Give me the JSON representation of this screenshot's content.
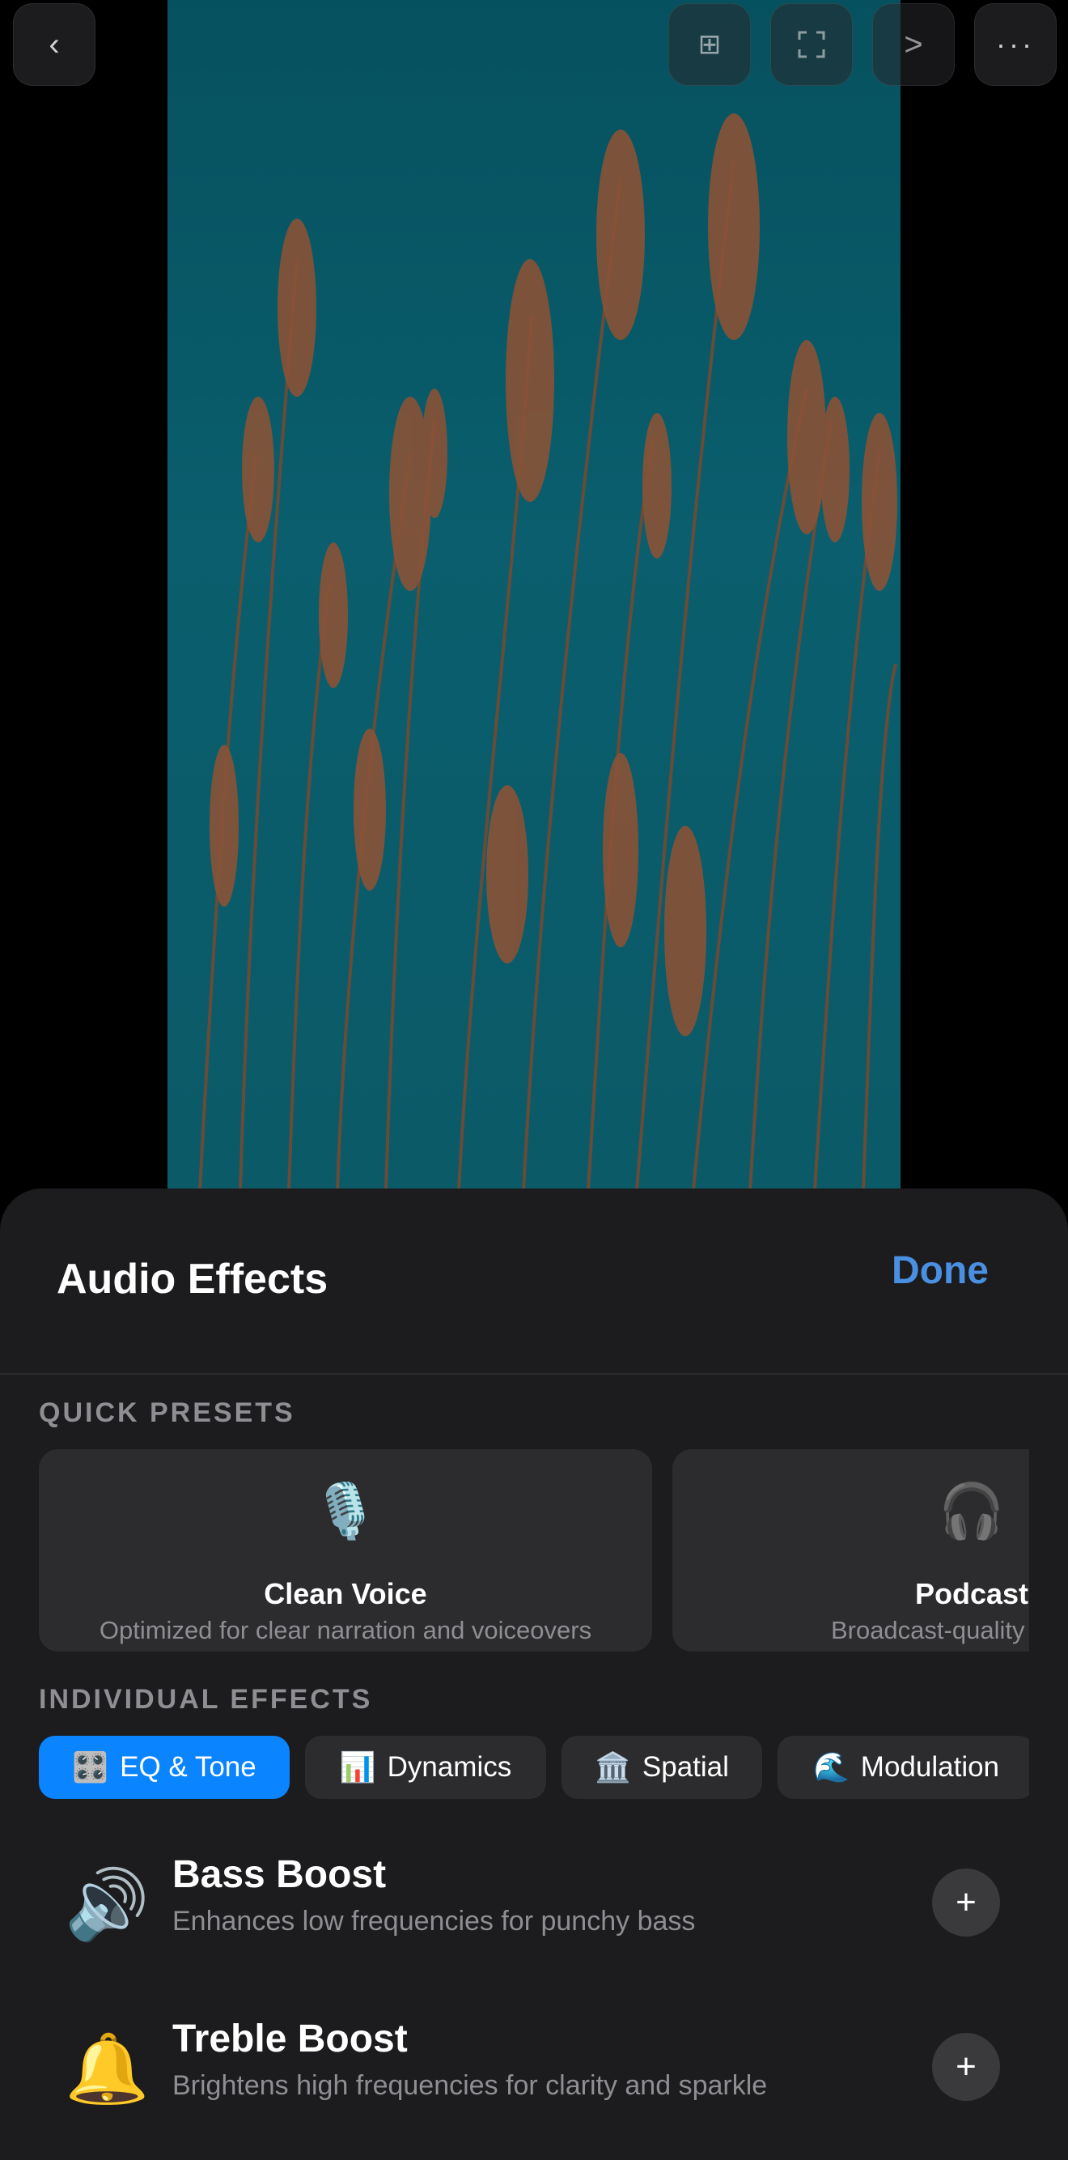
{
  "toolbar": {
    "back_icon": "chevron-left-icon",
    "grid_icon": "grid-icon",
    "fullscreen_icon": "fullscreen-icon",
    "next_label": ">",
    "more_icon": "ellipsis-icon"
  },
  "sheet": {
    "title": "Audio Effects",
    "done_label": "Done",
    "accent_color": "#4a90e2"
  },
  "quick_presets": {
    "label": "QUICK PRESETS",
    "items": [
      {
        "icon": "🎙️",
        "icon_name": "studio-microphone-icon",
        "name": "Clean Voice",
        "description": "Optimized for clear narration and voiceovers"
      },
      {
        "icon": "🎧",
        "icon_name": "headphones-icon",
        "name": "Podcast",
        "description": "Broadcast-quality speech"
      }
    ]
  },
  "individual_effects": {
    "label": "INDIVIDUAL EFFECTS",
    "tabs": [
      {
        "icon": "🎛️",
        "label": "EQ & Tone",
        "active": true
      },
      {
        "icon": "📊",
        "label": "Dynamics",
        "active": false
      },
      {
        "icon": "🏛️",
        "label": "Spatial",
        "active": false
      },
      {
        "icon": "🌊",
        "label": "Modulation",
        "active": false
      }
    ],
    "active_color": "#0a84ff",
    "items": [
      {
        "icon": "🔊",
        "icon_name": "speaker-icon",
        "name": "Bass Boost",
        "description": "Enhances low frequencies for punchy bass",
        "add_label": "+"
      },
      {
        "icon": "🔔",
        "icon_name": "bell-icon",
        "name": "Treble Boost",
        "description": "Brightens high frequencies for clarity and sparkle",
        "add_label": "+"
      }
    ]
  }
}
